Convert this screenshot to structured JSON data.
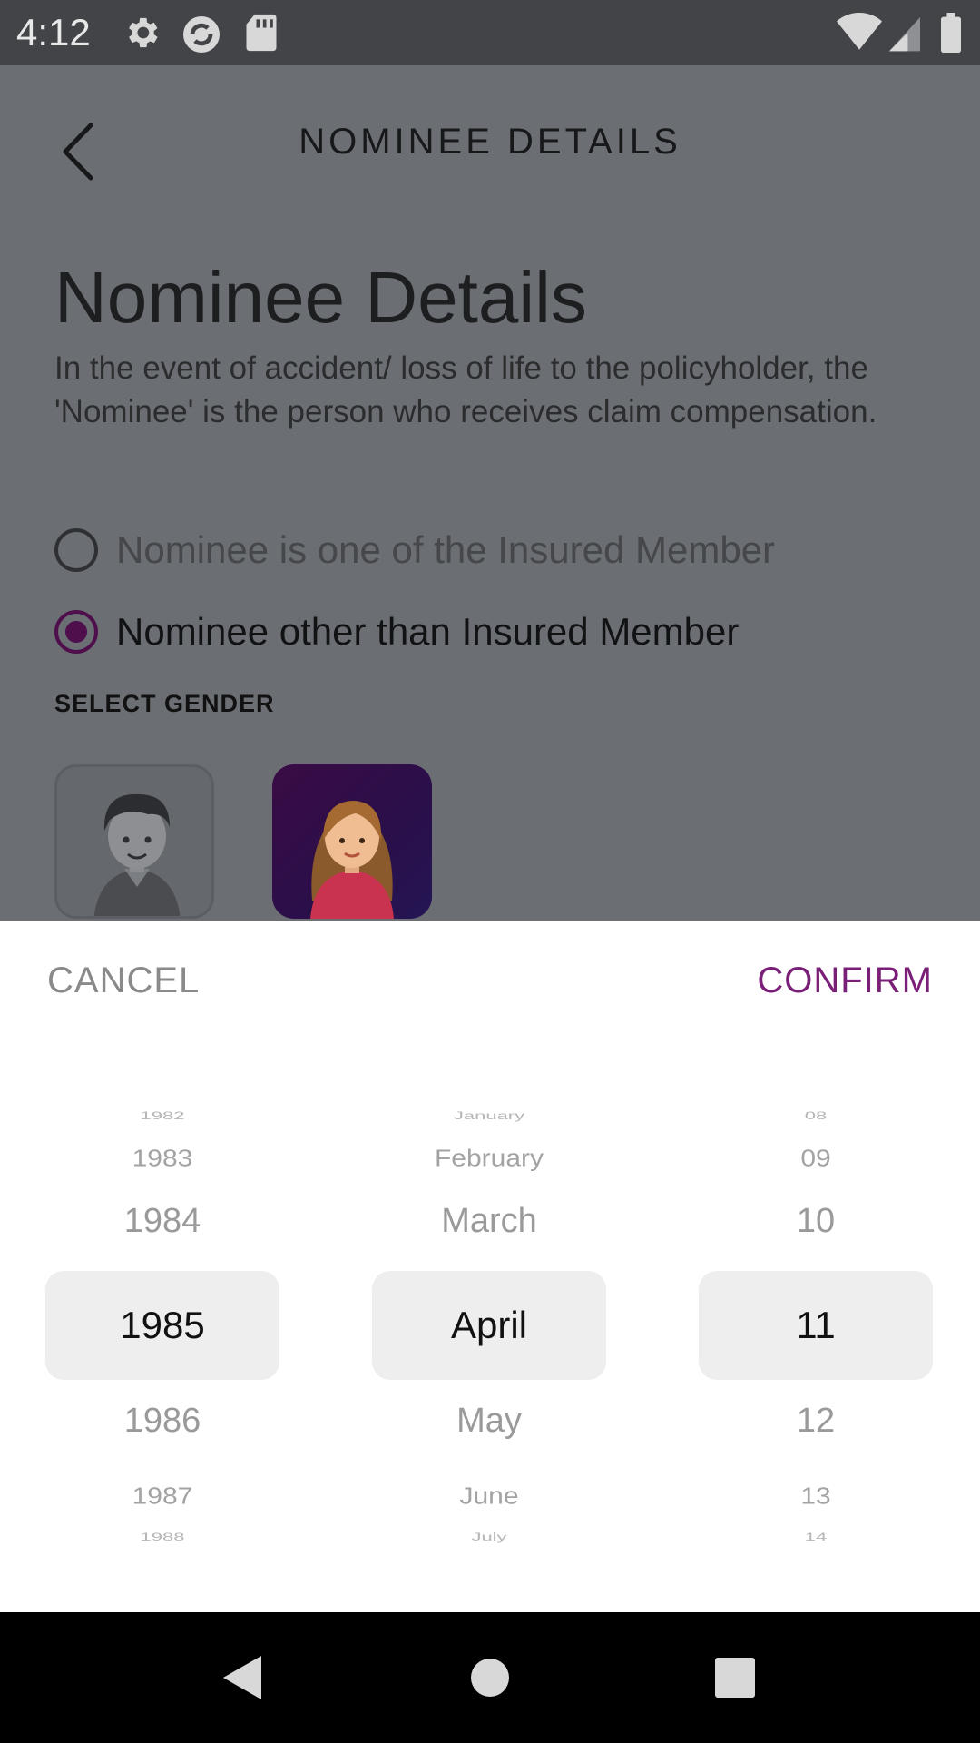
{
  "status_bar": {
    "time": "4:12",
    "icons": [
      "gear-icon",
      "sync-icon",
      "sd-card-icon",
      "wifi-icon",
      "signal-icon",
      "battery-icon"
    ]
  },
  "header": {
    "title": "NOMINEE DETAILS",
    "back_icon": "chevron-left-icon"
  },
  "content": {
    "title": "Nominee Details",
    "description": "In the event of accident/ loss of life to the policyholder, the 'Nominee' is the person who receives claim compensation.",
    "options": [
      {
        "label": "Nominee is one of the Insured Member",
        "selected": false
      },
      {
        "label": "Nominee other than Insured Member",
        "selected": true
      }
    ],
    "gender_label": "SELECT GENDER",
    "genders": [
      {
        "name": "male",
        "selected": false
      },
      {
        "name": "female",
        "selected": true
      }
    ]
  },
  "date_picker": {
    "cancel_label": "CANCEL",
    "confirm_label": "CONFIRM",
    "accent_color": "#7a1f78",
    "years": [
      "1982",
      "1983",
      "1984",
      "1985",
      "1986",
      "1987",
      "1988"
    ],
    "months": [
      "January",
      "February",
      "March",
      "April",
      "May",
      "June",
      "July"
    ],
    "days": [
      "08",
      "09",
      "10",
      "11",
      "12",
      "13",
      "14"
    ],
    "selected": {
      "year": "1985",
      "month": "April",
      "day": "11"
    }
  },
  "nav_bar": {
    "buttons": [
      "back-triangle-icon",
      "home-circle-icon",
      "recents-square-icon"
    ]
  }
}
